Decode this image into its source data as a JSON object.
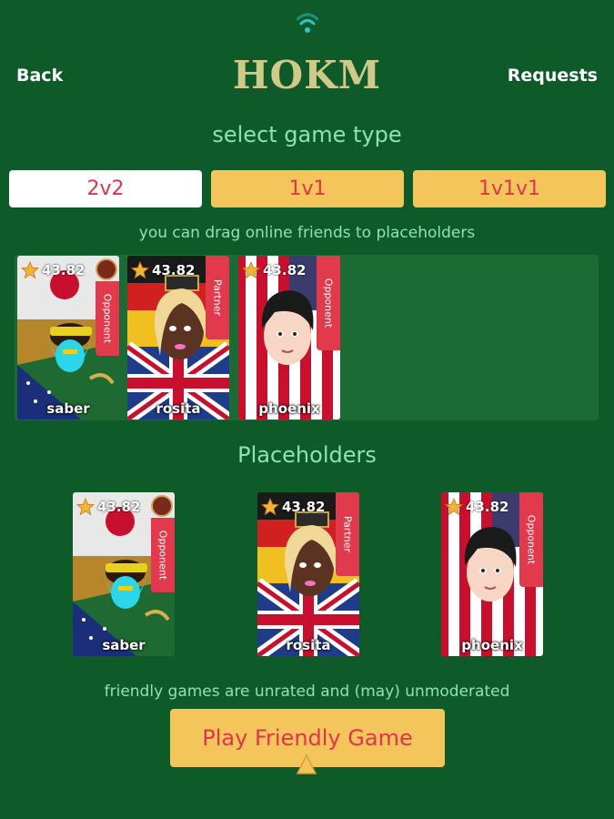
{
  "header": {
    "back_label": "Back",
    "title": "HOKM",
    "requests_label": "Requests"
  },
  "game_type": {
    "heading": "select game type",
    "options": [
      {
        "label": "2v2",
        "selected": true
      },
      {
        "label": "1v1",
        "selected": false
      },
      {
        "label": "1v1v1",
        "selected": false
      }
    ]
  },
  "friends": {
    "hint": "you can drag online friends to placeholders",
    "players": [
      {
        "name": "saber",
        "rating": "43.82",
        "role": "Opponent"
      },
      {
        "name": "rosita",
        "rating": "43.82",
        "role": "Partner"
      },
      {
        "name": "phoenix",
        "rating": "43.82",
        "role": "Opponent"
      }
    ]
  },
  "placeholders": {
    "heading": "Placeholders",
    "players": [
      {
        "name": "saber",
        "rating": "43.82",
        "role": "Opponent"
      },
      {
        "name": "rosita",
        "rating": "43.82",
        "role": "Partner"
      },
      {
        "name": "phoenix",
        "rating": "43.82",
        "role": "Opponent"
      }
    ]
  },
  "footer": {
    "note": "friendly games are unrated and (may) unmoderated",
    "play_label": "Play Friendly Game"
  },
  "colors": {
    "background": "#0e5a28",
    "accent": "#f4c55a",
    "text_red": "#e0344c",
    "heading_green": "#8fe3b0",
    "role_red": "#e03a4c"
  },
  "icons": [
    "wifi-icon",
    "star-icon",
    "rank-badge-icon",
    "pointer-triangle-icon"
  ]
}
